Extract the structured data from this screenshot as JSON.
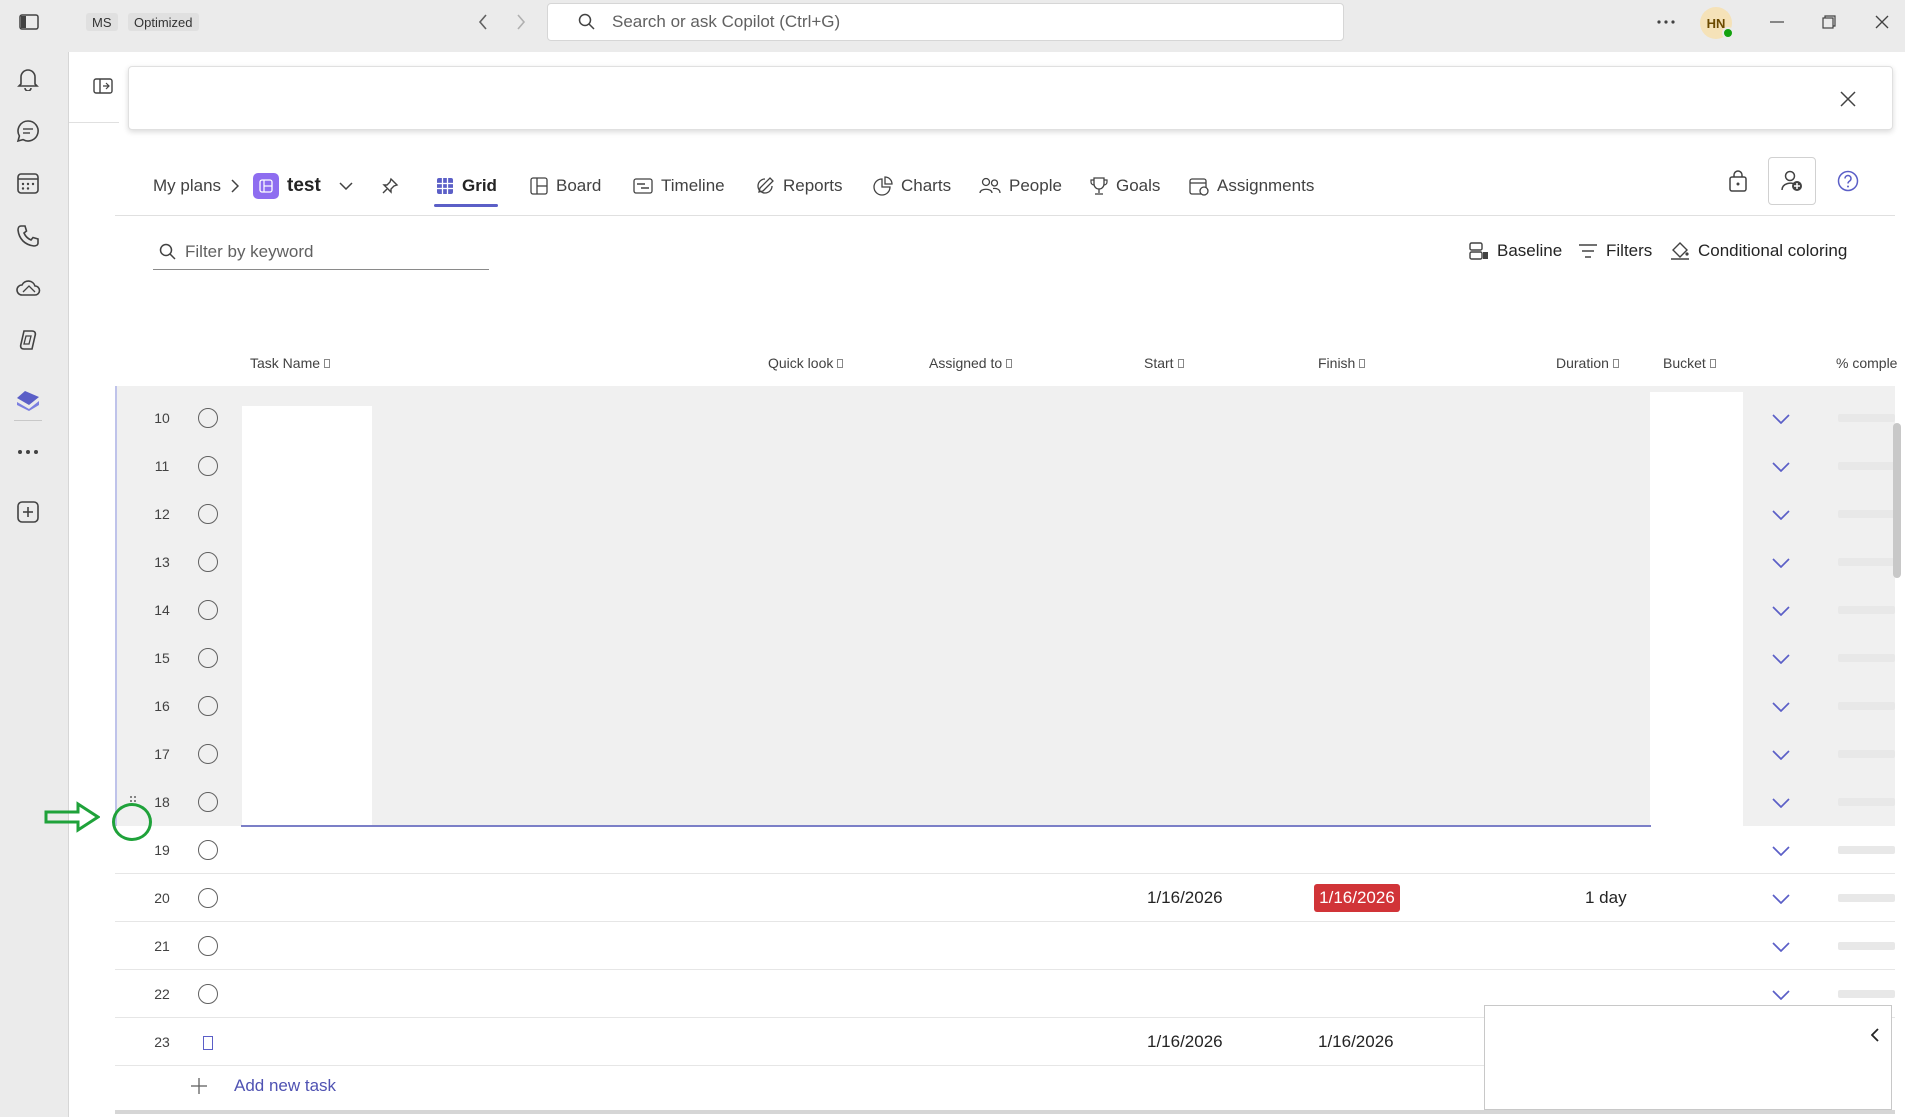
{
  "titlebar": {
    "account_badge": "MS",
    "mode_badge": "Optimized",
    "search_placeholder": "Search or ask Copilot (Ctrl+G)",
    "avatar_initials": "HN"
  },
  "rail": {
    "icons": [
      "activity-icon",
      "chat-icon",
      "calendar-icon",
      "calls-icon",
      "onedrive-icon",
      "copilot-icon",
      "planner-icon",
      "more-apps-icon",
      "add-app-icon"
    ]
  },
  "header": {
    "breadcrumb_root": "My plans",
    "plan_name": "test",
    "tabs": [
      {
        "label": "Grid",
        "active": true
      },
      {
        "label": "Board"
      },
      {
        "label": "Timeline"
      },
      {
        "label": "Reports"
      },
      {
        "label": "Charts"
      },
      {
        "label": "People"
      },
      {
        "label": "Goals"
      },
      {
        "label": "Assignments"
      }
    ]
  },
  "toolbar": {
    "filter_placeholder": "Filter by keyword",
    "baseline": "Baseline",
    "filters": "Filters",
    "conditional_coloring": "Conditional coloring"
  },
  "grid": {
    "columns": [
      "Task Name",
      "Quick look",
      "Assigned to",
      "Start",
      "Finish",
      "Duration",
      "Bucket",
      "% comple"
    ],
    "rows": [
      {
        "num": "10"
      },
      {
        "num": "11"
      },
      {
        "num": "12"
      },
      {
        "num": "13"
      },
      {
        "num": "14"
      },
      {
        "num": "15"
      },
      {
        "num": "16"
      },
      {
        "num": "17"
      },
      {
        "num": "18"
      },
      {
        "num": "19"
      },
      {
        "num": "20",
        "start": "1/16/2026",
        "finish": "1/16/2026",
        "duration": "1 day",
        "finish_late": true
      },
      {
        "num": "21"
      },
      {
        "num": "22"
      },
      {
        "num": "23",
        "start": "1/16/2026",
        "finish": "1/16/2026"
      }
    ],
    "add_task_label": "Add new task",
    "late_color": "#d13438"
  },
  "colors": {
    "accent": "#5b5fc7",
    "annotation": "#1fa23a"
  }
}
